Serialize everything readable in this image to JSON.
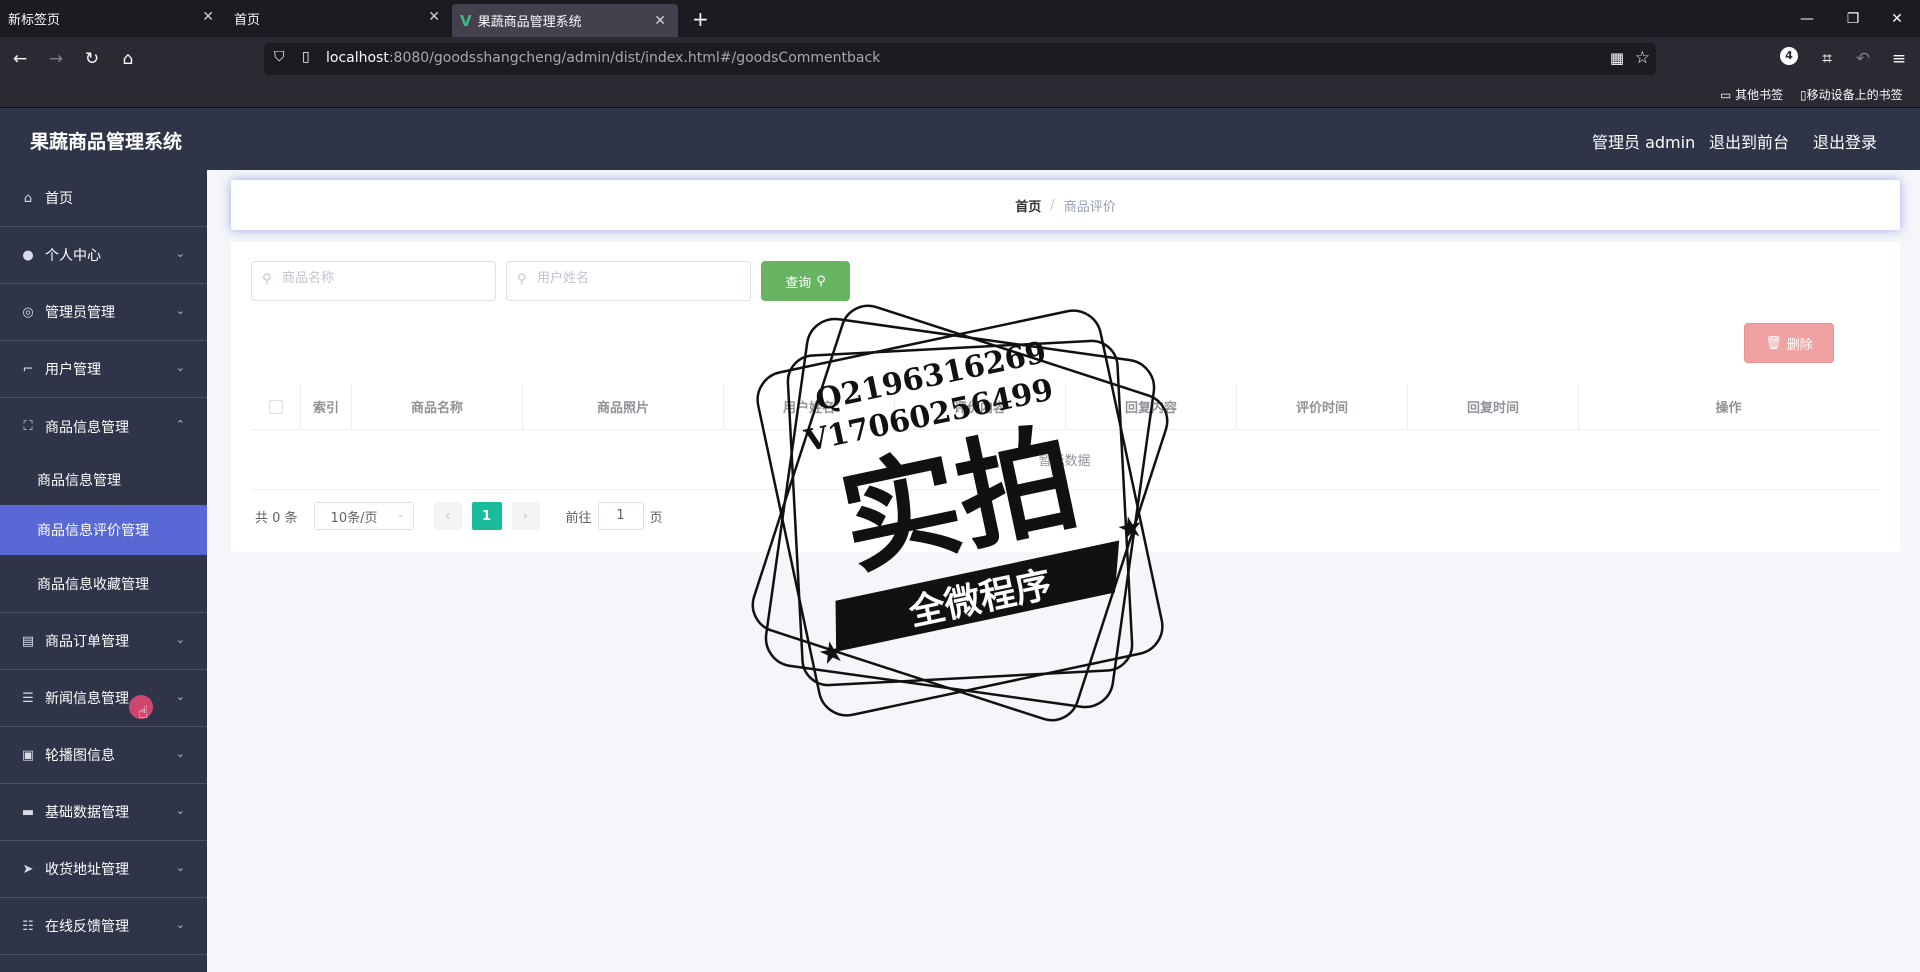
{
  "browser": {
    "tabs": [
      {
        "title": "新标签页",
        "active": false
      },
      {
        "title": "首页",
        "active": false
      },
      {
        "title": "果蔬商品管理系统",
        "active": true
      }
    ],
    "url_host": "localhost",
    "url_rest": ":8080/goodsshangcheng/admin/dist/index.html#/goodsCommentback",
    "bookmarks": [
      "其他书签",
      "移动设备上的书签"
    ],
    "extension_badge": "4"
  },
  "app": {
    "title": "果蔬商品管理系统",
    "header_links": {
      "user": "管理员 admin",
      "to_front": "退出到前台",
      "logout": "退出登录"
    }
  },
  "sidebar": {
    "items": [
      {
        "label": "首页",
        "icon": "home-icon",
        "has_arrow": false
      },
      {
        "label": "个人中心",
        "icon": "user-icon",
        "has_arrow": true
      },
      {
        "label": "管理员管理",
        "icon": "aperture-icon",
        "has_arrow": true
      },
      {
        "label": "用户管理",
        "icon": "crop-icon",
        "has_arrow": true
      },
      {
        "label": "商品信息管理",
        "icon": "fullscreen-icon",
        "has_arrow": true,
        "expanded": true
      },
      {
        "label": "商品订单管理",
        "icon": "clipboard-icon",
        "has_arrow": true
      },
      {
        "label": "新闻信息管理",
        "icon": "list-icon",
        "has_arrow": true
      },
      {
        "label": "轮播图信息",
        "icon": "briefcase-icon",
        "has_arrow": true
      },
      {
        "label": "基础数据管理",
        "icon": "monitor-icon",
        "has_arrow": true
      },
      {
        "label": "收货地址管理",
        "icon": "send-icon",
        "has_arrow": true
      },
      {
        "label": "在线反馈管理",
        "icon": "sliders-icon",
        "has_arrow": true
      }
    ],
    "submenu": [
      {
        "label": "商品信息管理",
        "active": false
      },
      {
        "label": "商品信息评价管理",
        "active": true
      },
      {
        "label": "商品信息收藏管理",
        "active": false
      }
    ]
  },
  "breadcrumb": {
    "home": "首页",
    "current": "商品评价"
  },
  "search": {
    "goods_name_placeholder": "商品名称",
    "user_name_placeholder": "用户姓名",
    "query_label": "查询"
  },
  "actions": {
    "delete_label": "删除"
  },
  "table": {
    "columns": [
      "索引",
      "商品名称",
      "商品照片",
      "用户姓名",
      "评价内容",
      "回复内容",
      "评价时间",
      "回复时间",
      "操作"
    ],
    "empty_text": "暂无数据"
  },
  "pagination": {
    "total": "共 0 条",
    "page_size": "10条/页",
    "current_page": "1",
    "goto_prefix": "前往",
    "goto_value": "1",
    "goto_suffix": "页"
  },
  "watermark": {
    "line1": "Q2196316269",
    "line2": "V17060256499",
    "main": "实拍",
    "ribbon": "全微程序"
  }
}
